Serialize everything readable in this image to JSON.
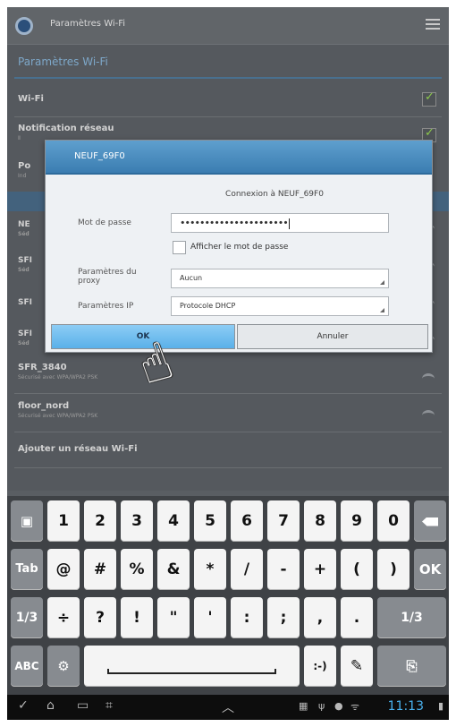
{
  "actionbar": {
    "title": "Paramètres Wi-Fi"
  },
  "page_title": "Paramètres Wi-Fi",
  "settings": {
    "wifi_label": "Wi-Fi",
    "notif_label": "Notification réseau",
    "notif_sub": "Ⅱ",
    "po_label": "Po",
    "po_sub": "Ind",
    "networks": [
      {
        "ssid": "NE",
        "sub": "Séd"
      },
      {
        "ssid": "SFI",
        "sub": "Séd"
      },
      {
        "ssid": "SFI",
        "sub": ""
      },
      {
        "ssid": "SFI",
        "sub": "Séd"
      },
      {
        "ssid": "SFR_3840",
        "sub": "Sécurisé avec WPA/WPA2 PSK"
      },
      {
        "ssid": "floor_nord",
        "sub": "Sécurisé avec WPA/WPA2 PSK"
      }
    ],
    "add_network": "Ajouter un réseau Wi-Fi"
  },
  "dialog": {
    "title": "NEUF_69F0",
    "connection_text": "Connexion à NEUF_69F0",
    "password_label": "Mot de passe",
    "password_value": "••••••••••••••••••••••",
    "show_password_label": "Afficher le mot de passe",
    "proxy_label_1": "Paramètres du",
    "proxy_label_2": "proxy",
    "proxy_value": "Aucun",
    "ip_label": "Paramètres IP",
    "ip_value": "Protocole DHCP",
    "ok_label": "OK",
    "cancel_label": "Annuler"
  },
  "keyboard": {
    "row1": [
      "1",
      "2",
      "3",
      "4",
      "5",
      "6",
      "7",
      "8",
      "9",
      "0"
    ],
    "row2": [
      "Tab",
      "@",
      "#",
      "%",
      "&",
      "*",
      "/",
      "-",
      "+",
      "(",
      ")",
      "OK"
    ],
    "row3": [
      "1/3",
      "÷",
      "?",
      "!",
      "\"",
      "'",
      ":",
      ";",
      ",",
      ".",
      "1/3"
    ],
    "abc_label": "ABC",
    "smiley_label": ":-)"
  },
  "sysbar": {
    "clock": "11:13"
  },
  "icons": [
    "app-icon",
    "menu-icon",
    "wifi-icon",
    "checkbox-icon",
    "hand-pointer-icon",
    "backspace-icon",
    "clipboard-icon",
    "settings-gear-icon",
    "handwriting-icon",
    "back-icon",
    "home-icon",
    "recent-apps-icon",
    "screenshot-icon"
  ],
  "colors": {
    "accent": "#3b7db1",
    "ok_button": "#5ab0e9",
    "clock": "#4ab3f0",
    "check": "#8cc84b"
  }
}
